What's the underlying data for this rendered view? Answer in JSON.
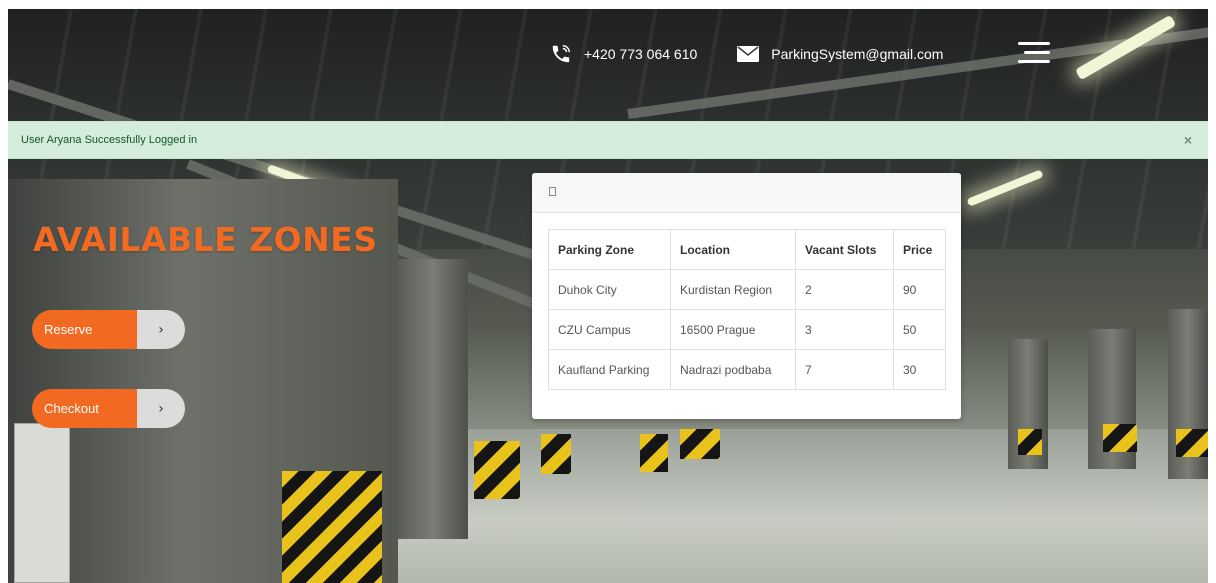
{
  "header": {
    "phone": "+420 773 064 610",
    "email": "ParkingSystem@gmail.com",
    "phone_icon": "phone-icon",
    "email_icon": "envelope-icon",
    "menu_icon": "hamburger-menu-icon"
  },
  "alert": {
    "message": "User Aryana Successfully Logged in",
    "close_label": "×",
    "color": "#d4eddb"
  },
  "main": {
    "title": "AVAILABLE ZONES",
    "accent_color": "#f26a21",
    "actions": [
      {
        "label": "Reserve",
        "arrow": "›"
      },
      {
        "label": "Checkout",
        "arrow": "›"
      }
    ]
  },
  "zones_table": {
    "columns": [
      "Parking Zone",
      "Location",
      "Vacant Slots",
      "Price"
    ],
    "rows": [
      [
        "Duhok City",
        "Kurdistan Region",
        "2",
        "90"
      ],
      [
        "CZU Campus",
        "16500 Prague",
        "3",
        "50"
      ],
      [
        "Kaufland Parking",
        "Nadrazi podbaba",
        "7",
        "30"
      ]
    ]
  }
}
